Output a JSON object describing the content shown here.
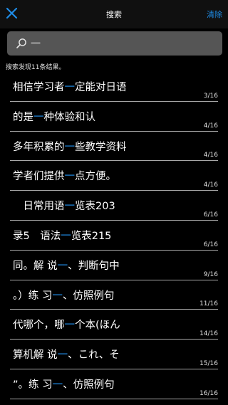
{
  "header": {
    "title": "搜索",
    "clear_label": "清除",
    "close_icon": "close-icon"
  },
  "search": {
    "query": "一",
    "placeholder": ""
  },
  "summary": "搜索发现11条结果。",
  "colors": {
    "accent": "#1f8ce6",
    "background": "#000000",
    "input_bg": "#555555",
    "divider": "#a8a8a8"
  },
  "results": [
    {
      "before": "相信学习者",
      "match": "一",
      "after": "定能对日语",
      "page": "3/16"
    },
    {
      "before": "的是",
      "match": "一",
      "after": "种体验和认",
      "page": "4/16"
    },
    {
      "before": "多年积累的",
      "match": "一",
      "after": "些教学资料",
      "page": "4/16"
    },
    {
      "before": "学者们提供",
      "match": "一",
      "after": "点方便。",
      "page": "4/16"
    },
    {
      "before": "　日常用语",
      "match": "一",
      "after": "览表203",
      "page": "6/16"
    },
    {
      "before": "录5　语法",
      "match": "一",
      "after": "览表215",
      "page": "6/16"
    },
    {
      "before": "同。解 说",
      "match": "一",
      "after": "、判断句中",
      "page": "9/16"
    },
    {
      "before": "。）练 习",
      "match": "一",
      "after": "、仿照例句",
      "page": "11/16"
    },
    {
      "before": "代哪个，哪",
      "match": "一",
      "after": "个本(ほん",
      "page": "14/16"
    },
    {
      "before": "算机解 说",
      "match": "一",
      "after": "、これ、そ",
      "page": "15/16"
    },
    {
      "before": "”。练 习",
      "match": "一",
      "after": "、仿照例句",
      "page": "16/16"
    }
  ]
}
